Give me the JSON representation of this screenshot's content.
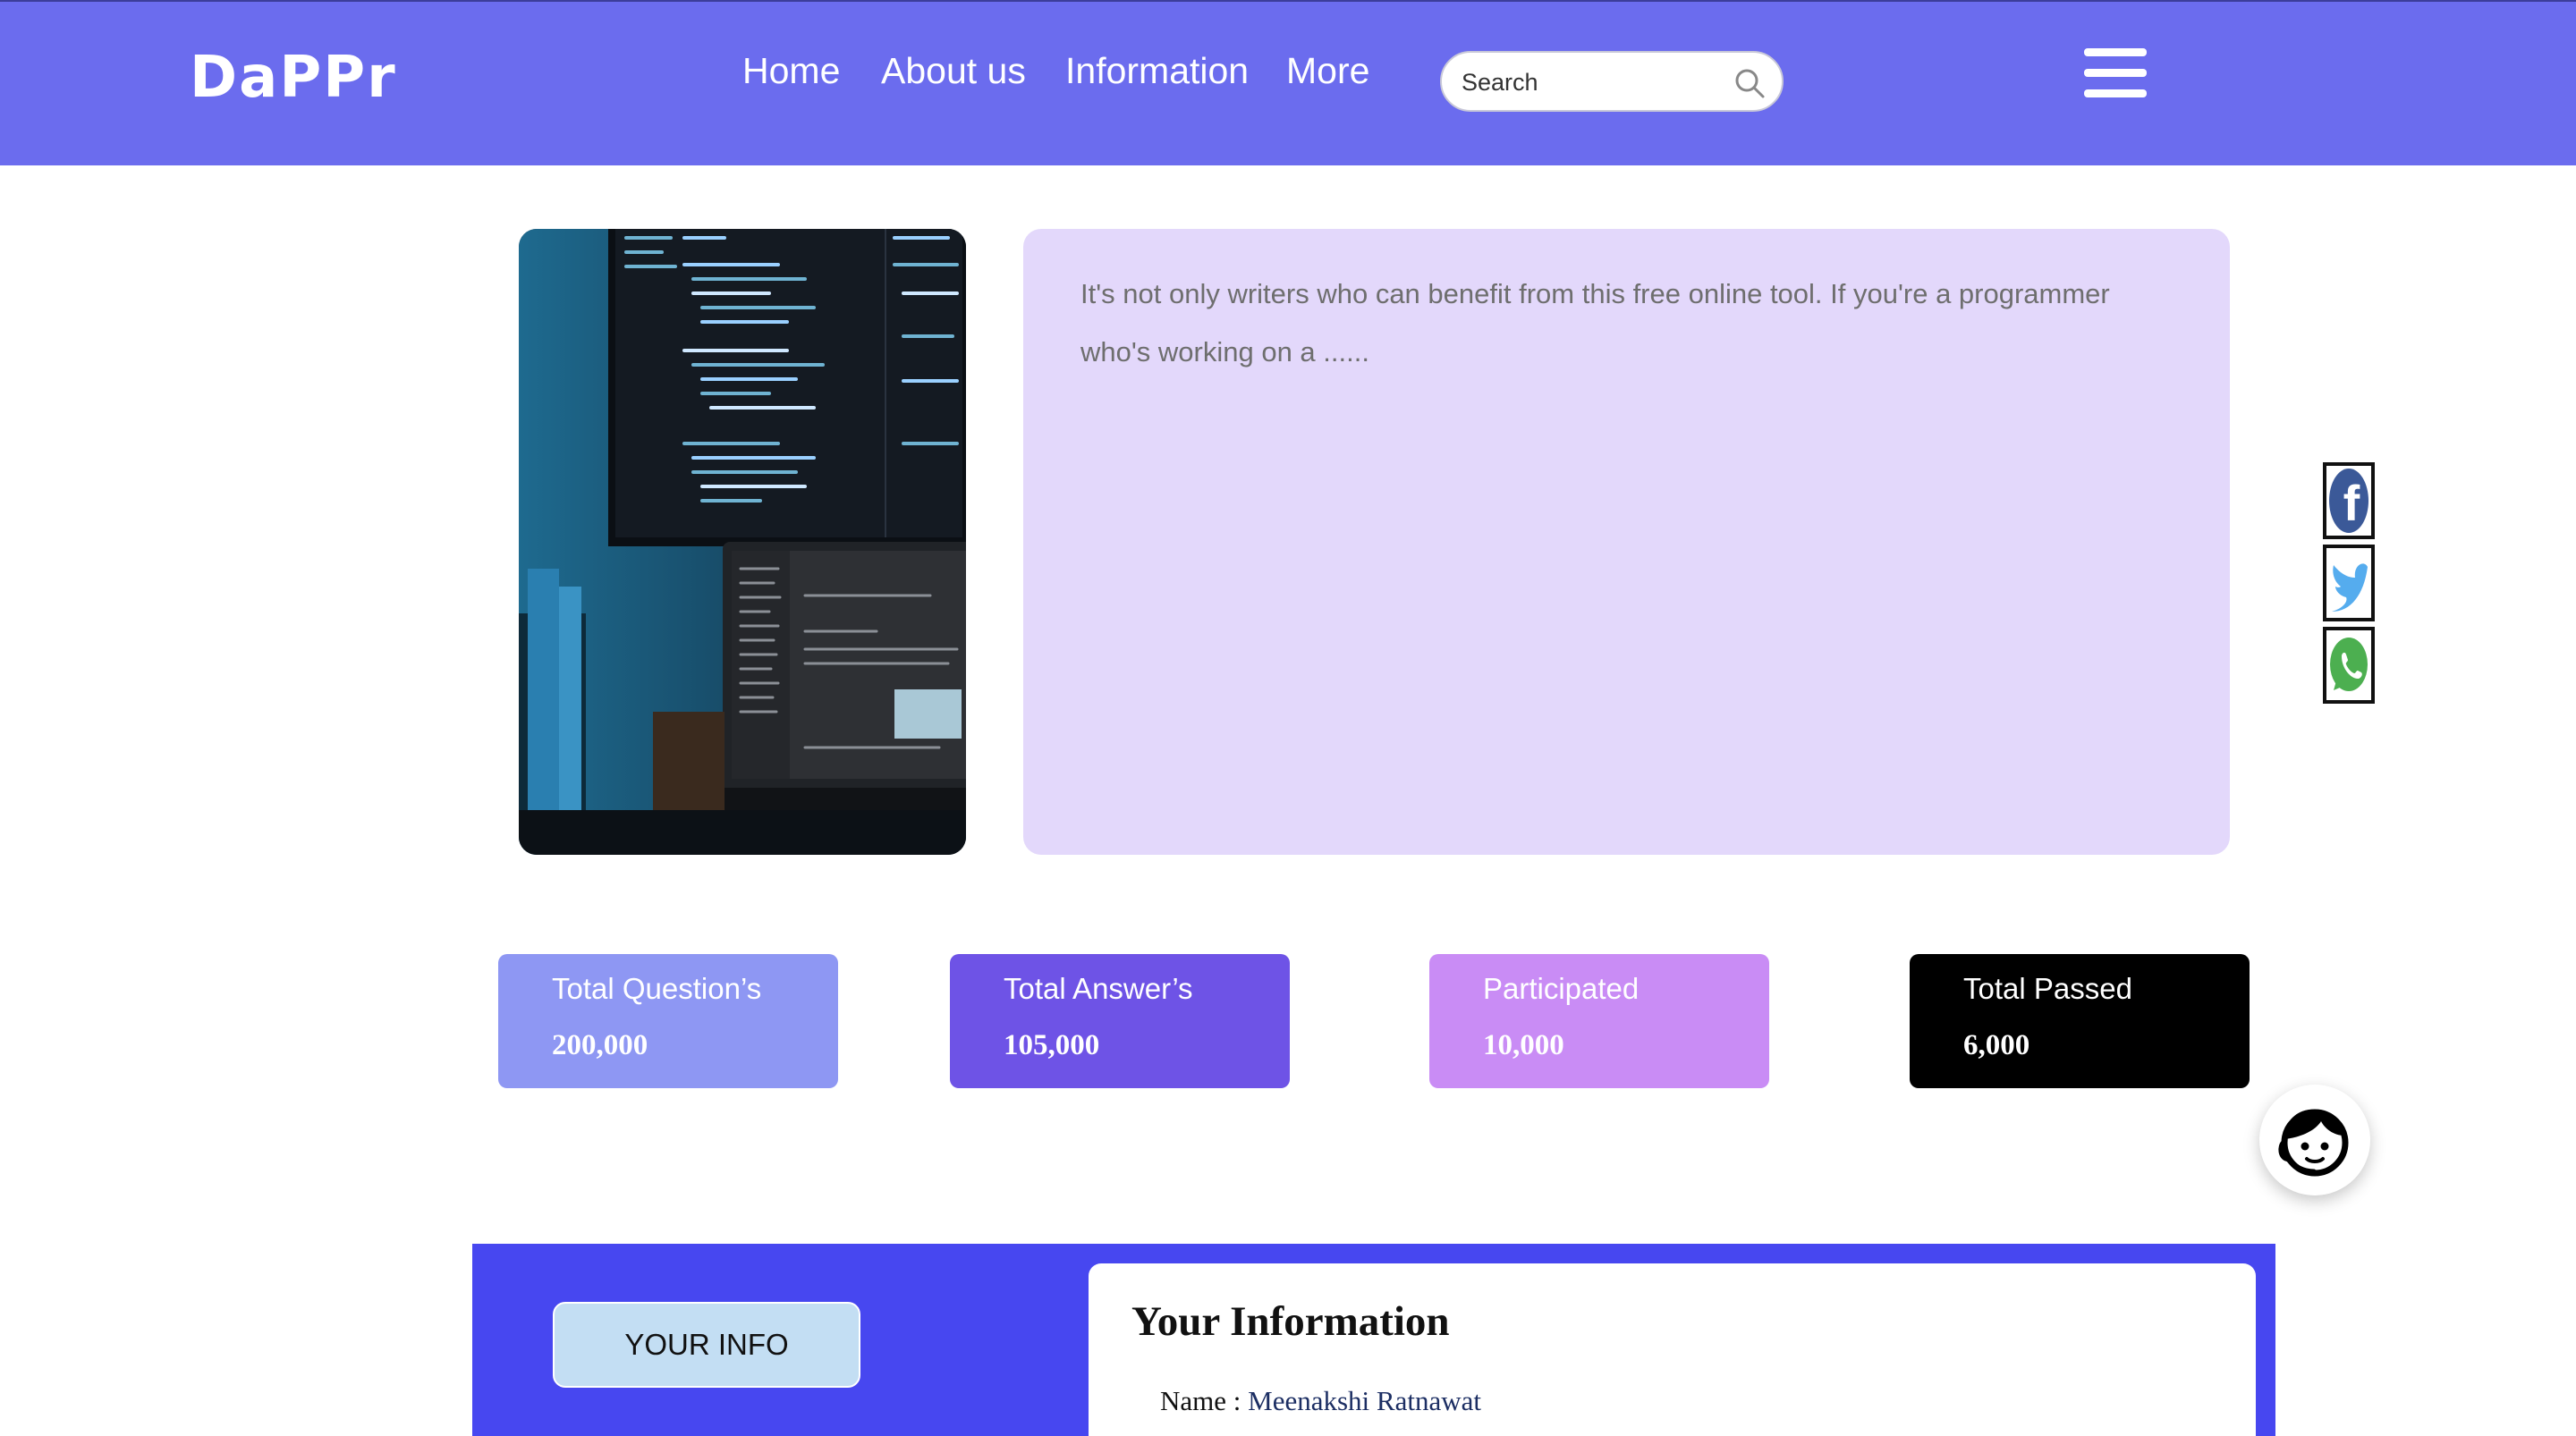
{
  "header": {
    "logo": "DaPPr",
    "nav": {
      "home": "Home",
      "about": "About us",
      "information": "Information",
      "more": "More"
    },
    "search": {
      "placeholder": "Search"
    },
    "icons": {
      "search": "search-icon",
      "menu": "hamburger-menu-icon"
    },
    "background_color": "#6b6cee"
  },
  "hero": {
    "image": "laptop-and-monitor-with-code-photo",
    "text": "It's not only writers who can benefit from this free online tool. If you're a programmer who's working on a ......",
    "card_color": "#e3d8fb"
  },
  "social": [
    {
      "name": "facebook-icon",
      "color": "#3b5998"
    },
    {
      "name": "twitter-icon",
      "color": "#55acee"
    },
    {
      "name": "whatsapp-icon",
      "color": "#4caf50"
    }
  ],
  "stats": [
    {
      "label": "Total Question’s",
      "value": "200,000",
      "color": "#8e97f3"
    },
    {
      "label": "Total Answer’s",
      "value": "105,000",
      "color": "#6e53e6"
    },
    {
      "label": "Participated",
      "value": "10,000",
      "color": "#c98cf5"
    },
    {
      "label": "Total Passed",
      "value": "6,000",
      "color": "#000000"
    }
  ],
  "chatbot": {
    "icon": "support-agent-icon"
  },
  "info_section": {
    "button_label": "YOUR INFO",
    "card_title": "Your Information",
    "name_label": "Name : ",
    "name_value": "Meenakshi Ratnawat",
    "background_color": "#4747f0"
  }
}
